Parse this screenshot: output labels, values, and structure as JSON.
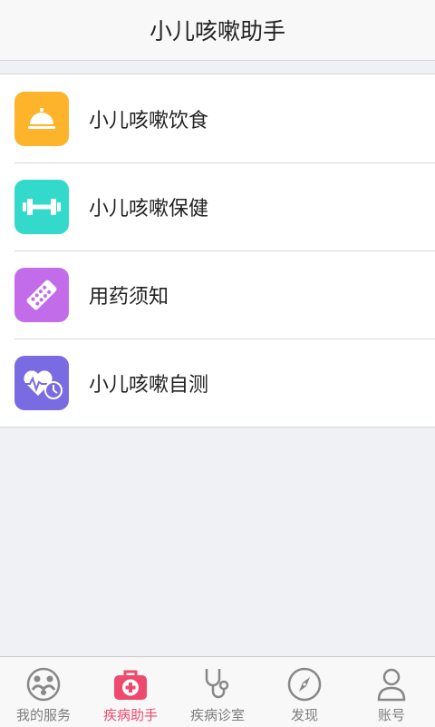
{
  "header": {
    "title": "小儿咳嗽助手"
  },
  "menu": {
    "items": [
      {
        "label": "小儿咳嗽饮食",
        "icon": "service-bell-icon",
        "color": "#FDB32A"
      },
      {
        "label": "小儿咳嗽保健",
        "icon": "dumbbell-icon",
        "color": "#33D9CB"
      },
      {
        "label": "用药须知",
        "icon": "pill-strip-icon",
        "color": "#C36CEA"
      },
      {
        "label": "小儿咳嗽自测",
        "icon": "heart-monitor-icon",
        "color": "#7B6BE3"
      }
    ]
  },
  "tabbar": {
    "active_color": "#EE4A6E",
    "tabs": [
      {
        "label": "我的服务",
        "icon": "family-icon",
        "active": false
      },
      {
        "label": "疾病助手",
        "icon": "medical-kit-icon",
        "active": true
      },
      {
        "label": "疾病诊室",
        "icon": "stethoscope-icon",
        "active": false
      },
      {
        "label": "发现",
        "icon": "compass-icon",
        "active": false
      },
      {
        "label": "账号",
        "icon": "user-icon",
        "active": false
      }
    ]
  }
}
